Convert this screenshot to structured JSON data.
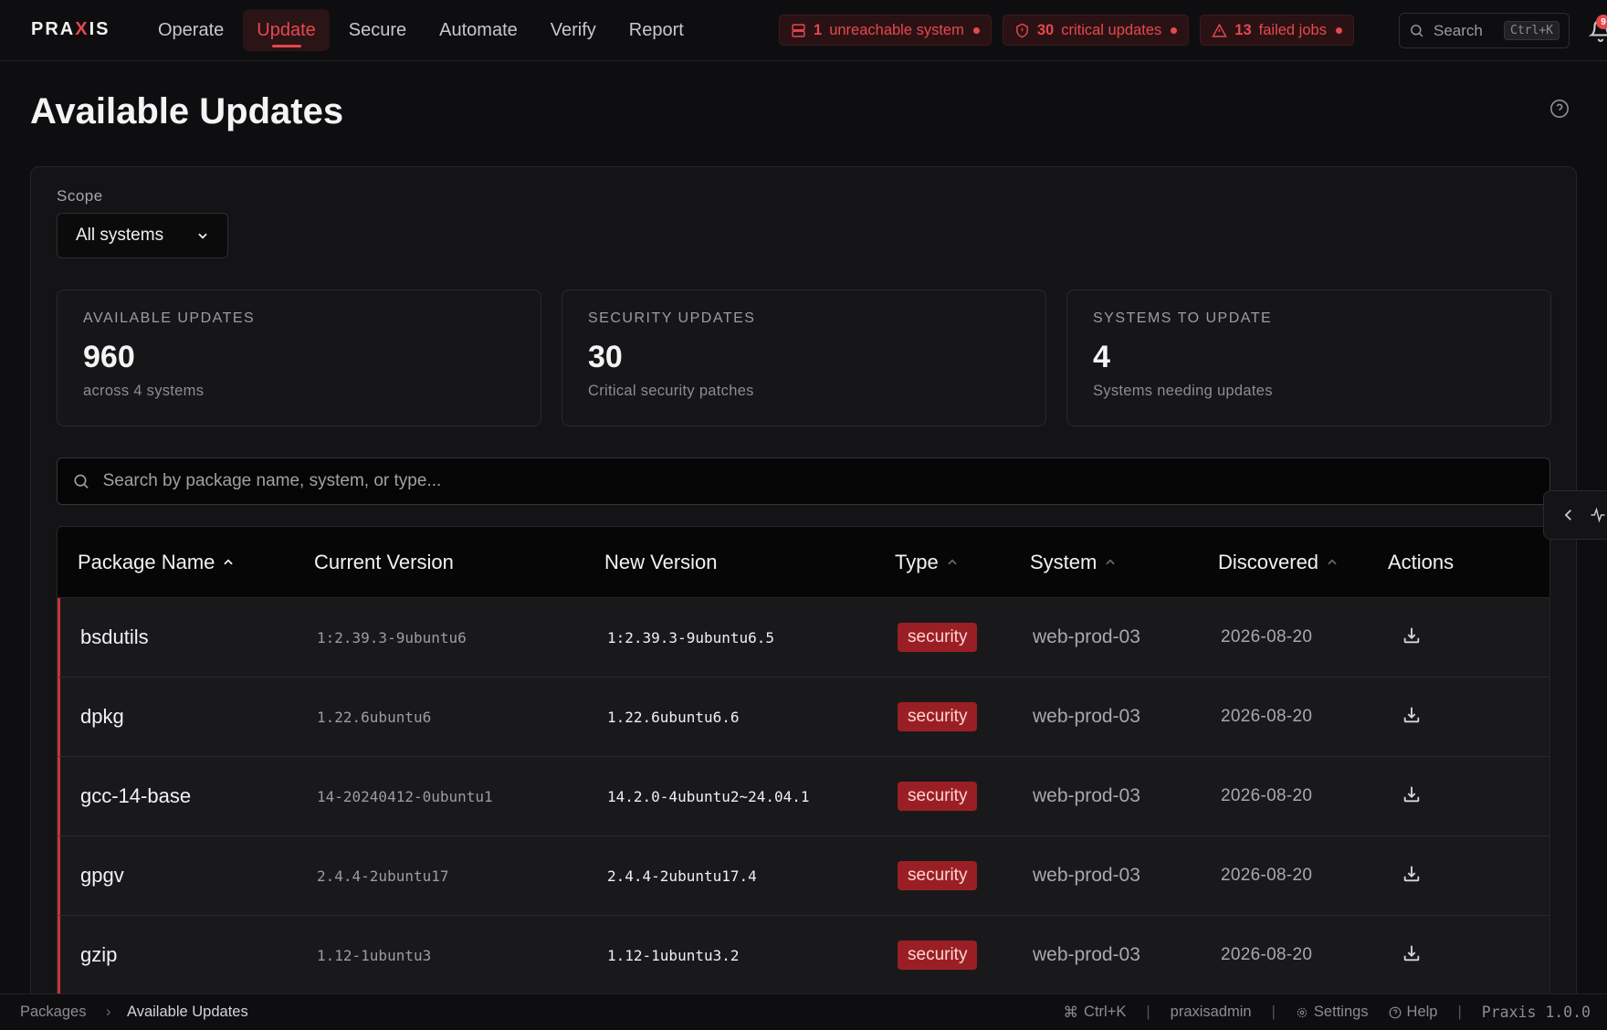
{
  "app": {
    "logo_left": "PRA",
    "logo_x": "X",
    "logo_right": "IS",
    "accent_color": "#e5484d"
  },
  "nav": {
    "items": [
      {
        "label": "Operate"
      },
      {
        "label": "Update",
        "active": true
      },
      {
        "label": "Secure"
      },
      {
        "label": "Automate"
      },
      {
        "label": "Verify"
      },
      {
        "label": "Report"
      }
    ]
  },
  "alerts": [
    {
      "icon": "server-icon",
      "count": "1",
      "text": "unreachable system"
    },
    {
      "icon": "shield-icon",
      "count": "30",
      "text": "critical updates"
    },
    {
      "icon": "warning-triangle-icon",
      "count": "13",
      "text": "failed jobs"
    }
  ],
  "top_search": {
    "label": "Search",
    "shortcut": "Ctrl+K"
  },
  "notifications": {
    "count": "9"
  },
  "page": {
    "title": "Available Updates"
  },
  "scope": {
    "label": "Scope",
    "selected": "All systems"
  },
  "stats": [
    {
      "label": "AVAILABLE UPDATES",
      "value": "960",
      "sub": "across 4 systems"
    },
    {
      "label": "SECURITY UPDATES",
      "value": "30",
      "sub": "Critical security patches"
    },
    {
      "label": "SYSTEMS TO UPDATE",
      "value": "4",
      "sub": "Systems needing updates"
    }
  ],
  "table_search": {
    "placeholder": "Search by package name, system, or type..."
  },
  "table": {
    "headers": {
      "package": "Package Name",
      "current": "Current Version",
      "new": "New Version",
      "type": "Type",
      "system": "System",
      "discovered": "Discovered",
      "actions": "Actions"
    },
    "rows": [
      {
        "package": "bsdutils",
        "current": "1:2.39.3-9ubuntu6",
        "new": "1:2.39.3-9ubuntu6.5",
        "type": "security",
        "system": "web-prod-03",
        "discovered": "2026-08-20"
      },
      {
        "package": "dpkg",
        "current": "1.22.6ubuntu6",
        "new": "1.22.6ubuntu6.6",
        "type": "security",
        "system": "web-prod-03",
        "discovered": "2026-08-20"
      },
      {
        "package": "gcc-14-base",
        "current": "14-20240412-0ubuntu1",
        "new": "14.2.0-4ubuntu2~24.04.1",
        "type": "security",
        "system": "web-prod-03",
        "discovered": "2026-08-20"
      },
      {
        "package": "gpgv",
        "current": "2.4.4-2ubuntu17",
        "new": "2.4.4-2ubuntu17.4",
        "type": "security",
        "system": "web-prod-03",
        "discovered": "2026-08-20"
      },
      {
        "package": "gzip",
        "current": "1.12-1ubuntu3",
        "new": "1.12-1ubuntu3.2",
        "type": "security",
        "system": "web-prod-03",
        "discovered": "2026-08-20"
      }
    ]
  },
  "footer": {
    "breadcrumb": [
      "Packages",
      "Available Updates"
    ],
    "shortcut": "Ctrl+K",
    "user": "praxisadmin",
    "settings": "Settings",
    "help": "Help",
    "version": "Praxis 1.0.0"
  }
}
